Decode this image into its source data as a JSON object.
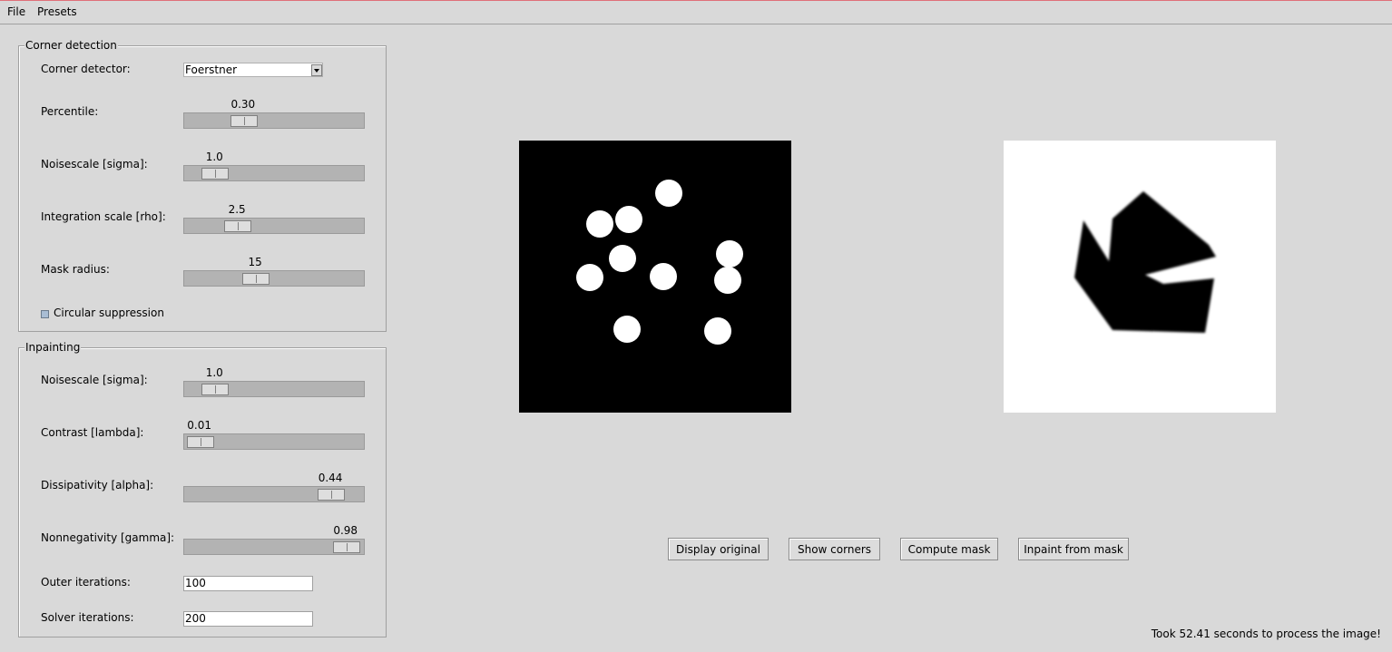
{
  "menu": {
    "file": "File",
    "presets": "Presets"
  },
  "corner": {
    "title": "Corner detection",
    "detector_label": "Corner detector:",
    "detector_value": "Foerstner",
    "percentile": {
      "label": "Percentile:",
      "value": "0.30",
      "fraction": 0.3
    },
    "noisescale": {
      "label": "Noisescale [sigma]:",
      "value": "1.0",
      "fraction": 0.11
    },
    "integration": {
      "label": "Integration scale [rho]:",
      "value": "2.5",
      "fraction": 0.26
    },
    "mask_radius": {
      "label": "Mask radius:",
      "value": "15",
      "fraction": 0.38
    },
    "circular_label": "Circular suppression"
  },
  "inpaint": {
    "title": "Inpainting",
    "noisescale": {
      "label": "Noisescale [sigma]:",
      "value": "1.0",
      "fraction": 0.11
    },
    "contrast": {
      "label": "Contrast [lambda]:",
      "value": "0.01",
      "fraction": 0.01
    },
    "dissipativity": {
      "label": "Dissipativity [alpha]:",
      "value": "0.44",
      "fraction": 0.88
    },
    "nonnegativity": {
      "label": "Nonnegativity [gamma]:",
      "value": "0.98",
      "fraction": 0.98
    },
    "outer_label": "Outer iterations:",
    "outer_value": "100",
    "solver_label": "Solver iterations:",
    "solver_value": "200"
  },
  "buttons": {
    "display_original": "Display original",
    "show_corners": "Show corners",
    "compute_mask": "Compute mask",
    "inpaint_from_mask": "Inpaint from mask"
  },
  "status": "Took 52.41 seconds to process the image!"
}
